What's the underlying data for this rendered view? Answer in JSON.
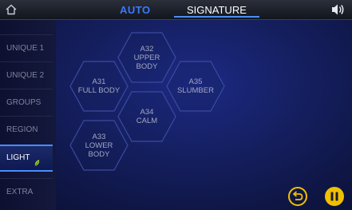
{
  "header": {
    "home_icon": "home-icon",
    "mode_auto": "AUTO",
    "mode_signature": "SIGNATURE",
    "sound_icon": "speaker-icon"
  },
  "sidebar": {
    "items": [
      {
        "label": "UNIQUE 1"
      },
      {
        "label": "UNIQUE 2"
      },
      {
        "label": "GROUPS"
      },
      {
        "label": "REGION"
      },
      {
        "label": "LIGHT",
        "active": true,
        "icon": "leaf-icon"
      },
      {
        "label": "EXTRA"
      }
    ]
  },
  "programs": [
    {
      "code": "A32",
      "lines": [
        "UPPER",
        "BODY"
      ]
    },
    {
      "code": "A31",
      "lines": [
        "FULL BODY"
      ]
    },
    {
      "code": "A35",
      "lines": [
        "SLUMBER"
      ]
    },
    {
      "code": "A34",
      "lines": [
        "CALM"
      ]
    },
    {
      "code": "A33",
      "lines": [
        "LOWER",
        "BODY"
      ]
    }
  ],
  "controls": {
    "back_icon": "return-icon",
    "pause_icon": "pause-icon"
  },
  "colors": {
    "accent_blue": "#4a8dff",
    "gold": "#f0c000",
    "hex_border": "#3c4aa0",
    "hex_text": "#a3a8bf"
  }
}
